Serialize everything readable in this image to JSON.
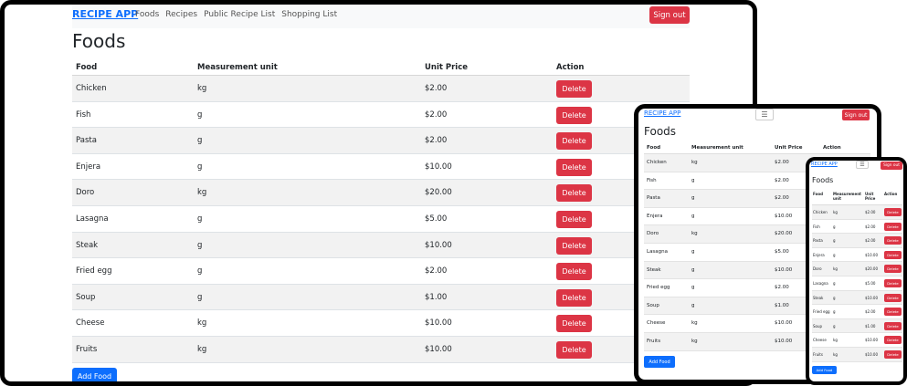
{
  "nav": {
    "brand": "RECIPE APP",
    "links": [
      "Foods",
      "Recipes",
      "Public Recipe List",
      "Shopping List"
    ],
    "sign_out": "Sign out",
    "menu_icon": "hamburger-menu-icon"
  },
  "page": {
    "title": "Foods",
    "add_button": "Add Food"
  },
  "table": {
    "headers": [
      "Food",
      "Measurement unit",
      "Unit Price",
      "Action"
    ],
    "delete_label": "Delete",
    "rows": [
      {
        "food": "Chicken",
        "unit": "kg",
        "price": "$2.00"
      },
      {
        "food": "Fish",
        "unit": "g",
        "price": "$2.00"
      },
      {
        "food": "Pasta",
        "unit": "g",
        "price": "$2.00"
      },
      {
        "food": "Enjera",
        "unit": "g",
        "price": "$10.00"
      },
      {
        "food": "Doro",
        "unit": "kg",
        "price": "$20.00"
      },
      {
        "food": "Lasagna",
        "unit": "g",
        "price": "$5.00"
      },
      {
        "food": "Steak",
        "unit": "g",
        "price": "$10.00"
      },
      {
        "food": "Fried egg",
        "unit": "g",
        "price": "$2.00"
      },
      {
        "food": "Soup",
        "unit": "g",
        "price": "$1.00"
      },
      {
        "food": "Cheese",
        "unit": "kg",
        "price": "$10.00"
      },
      {
        "food": "Fruits",
        "unit": "kg",
        "price": "$10.00"
      }
    ]
  },
  "colors": {
    "primary": "#0d6efd",
    "danger": "#dc3545",
    "navbar_bg": "#f8f9fa",
    "stripe": "#f2f2f2"
  }
}
